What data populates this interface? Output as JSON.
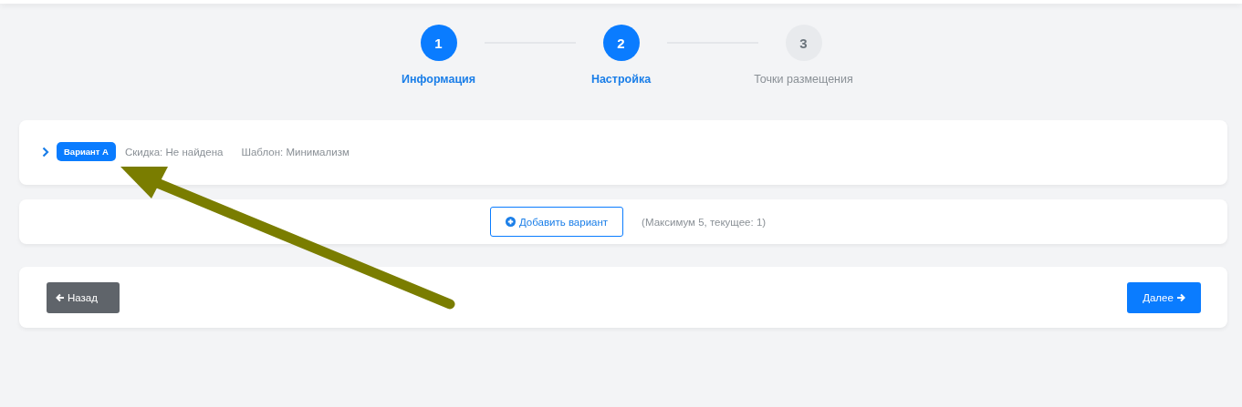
{
  "steps": [
    {
      "number": "1",
      "label": "Информация",
      "active": true
    },
    {
      "number": "2",
      "label": "Настройка",
      "active": true
    },
    {
      "number": "3",
      "label": "Точки размещения",
      "active": false
    }
  ],
  "variants": [
    {
      "badge": "Вариант А",
      "expanded": false,
      "discount": "Скидка: Не найдена",
      "template": "Шаблон: Минимализм"
    }
  ],
  "add_button": "Добавить вариант",
  "limit_note": "(Максимум 5, текущее: 1)",
  "back_button": "Назад",
  "next_button": "Далее"
}
